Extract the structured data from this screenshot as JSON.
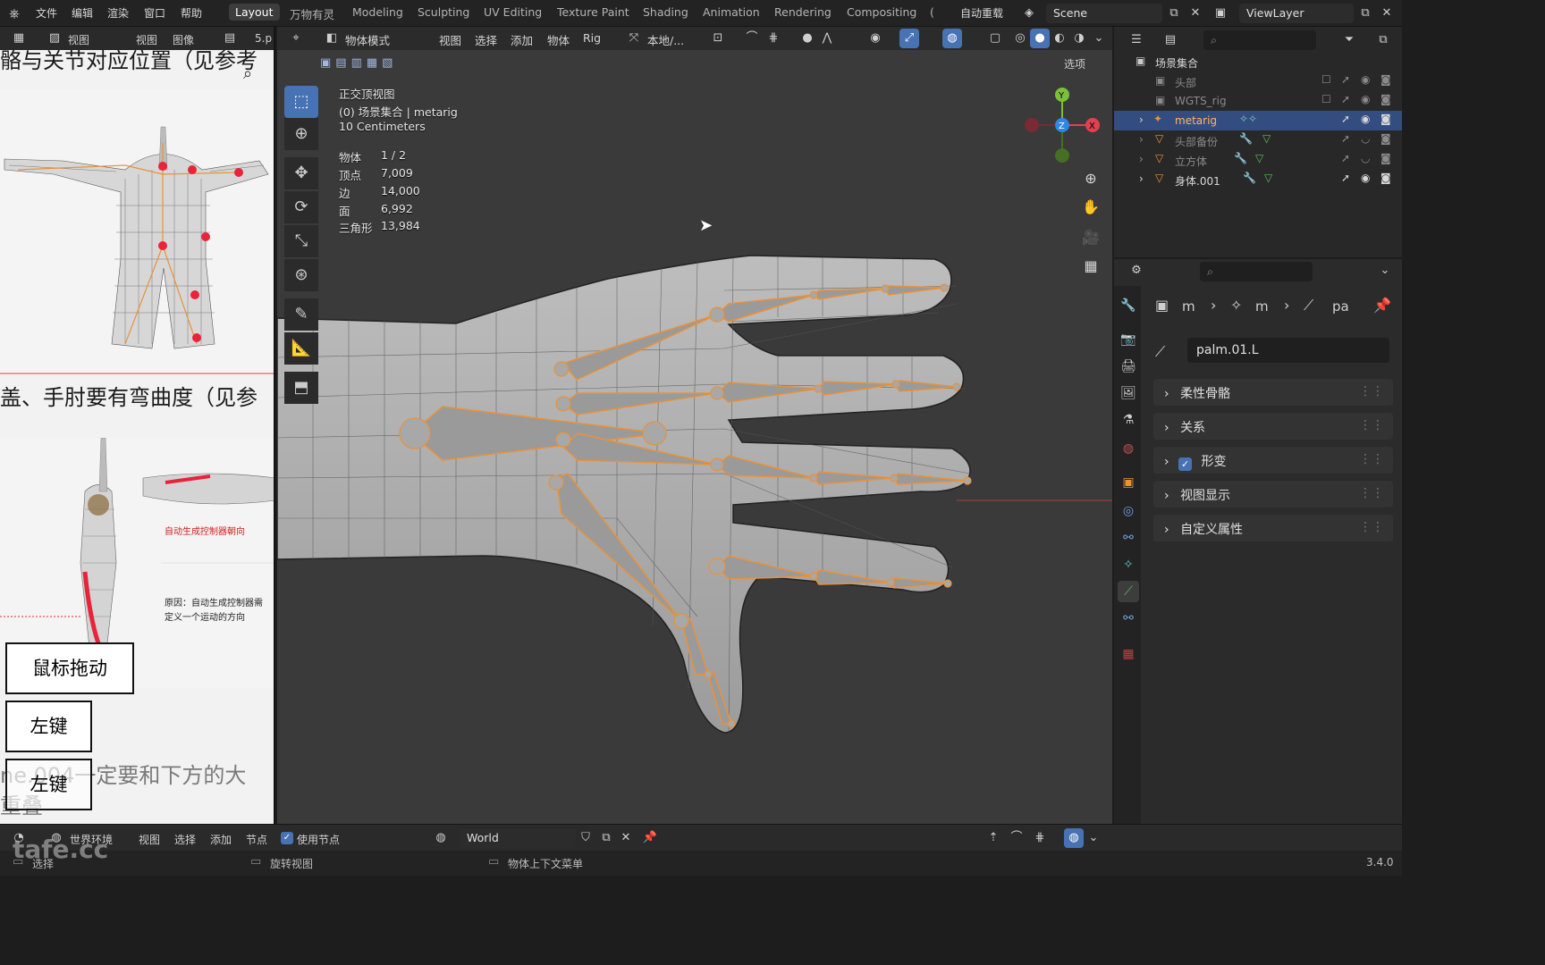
{
  "topbar": {
    "menus": [
      "文件",
      "编辑",
      "渲染",
      "窗口",
      "帮助"
    ],
    "workspaces": [
      "Layout",
      "万物有灵",
      "Modeling",
      "Sculpting",
      "UV Editing",
      "Texture Paint",
      "Shading",
      "Animation",
      "Rendering",
      "Compositing"
    ],
    "overflow": "(",
    "auto_reload": "自动重载",
    "scene_name": "Scene",
    "view_layer": "ViewLayer"
  },
  "left_editor": {
    "header": {
      "view": "视图",
      "view2": "视图",
      "image": "图像",
      "filename": "5.p"
    },
    "doc_lines": [
      "骼与关节对应位置（见参考",
      "盖、手肘要有弯曲度（见参",
      "ne.004一定要和下方的大",
      "重叠"
    ],
    "annotation_red": "自动生成控制器朝向",
    "annotation_note": "原因：自动生成控制器需",
    "annotation_note2": "定义一个运动的方向"
  },
  "key_overlays": [
    "鼠标拖动",
    "左键",
    "左键"
  ],
  "viewport": {
    "header": {
      "mode": "物体模式",
      "menus": [
        "视图",
        "选择",
        "添加",
        "物体",
        "Rig"
      ],
      "transform": "本地/...",
      "options": "选项"
    },
    "view_name": "正交顶视图",
    "collection_line": "(0) 场景集合 | metarig",
    "scale": "10 Centimeters",
    "stats": [
      {
        "label": "物体",
        "value": "1 / 2"
      },
      {
        "label": "顶点",
        "value": "7,009"
      },
      {
        "label": "边",
        "value": "14,000"
      },
      {
        "label": "面",
        "value": "6,992"
      },
      {
        "label": "三角形",
        "value": "13,984"
      }
    ],
    "gizmo": {
      "y": "Y",
      "z": "Z",
      "x": "X"
    }
  },
  "outliner": {
    "root": "场景集合",
    "items": [
      {
        "name": "头部",
        "type": "collection",
        "selected": false
      },
      {
        "name": "WGTS_rig",
        "type": "collection",
        "selected": false
      },
      {
        "name": "metarig",
        "type": "armature",
        "selected": true
      },
      {
        "name": "头部备份",
        "type": "mesh",
        "selected": false
      },
      {
        "name": "立方体",
        "type": "mesh",
        "selected": false
      },
      {
        "name": "身体.001",
        "type": "mesh",
        "selected": false
      }
    ]
  },
  "properties": {
    "breadcrumb": [
      "m",
      "m",
      "pa"
    ],
    "bone_name": "palm.01.L",
    "panels": [
      {
        "label": "柔性骨骼",
        "checkbox": false
      },
      {
        "label": "关系",
        "checkbox": false
      },
      {
        "label": "形变",
        "checkbox": true
      },
      {
        "label": "视图显示",
        "checkbox": false
      },
      {
        "label": "自定义属性",
        "checkbox": false
      }
    ]
  },
  "bottom_editor": {
    "env": "世界环境",
    "menus": [
      "视图",
      "选择",
      "添加",
      "节点"
    ],
    "use_nodes": "使用节点",
    "world": "World"
  },
  "statusbar": {
    "left": "选择",
    "mid": "旋转视图",
    "right": "物体上下文菜单",
    "version": "3.4.0",
    "watermark": "tafe.cc"
  },
  "colors": {
    "accent": "#4772b3",
    "selected_row": "#334d80",
    "bone_orange": "#e8923a"
  }
}
